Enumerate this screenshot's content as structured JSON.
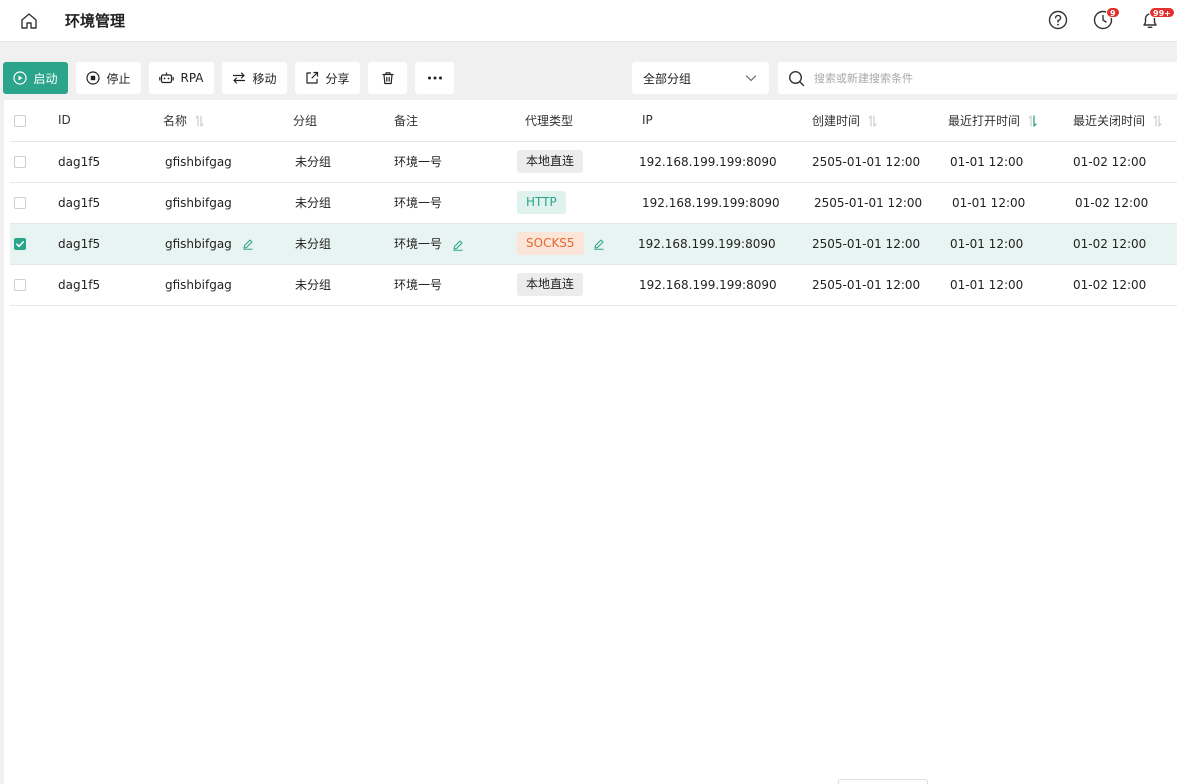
{
  "header": {
    "title": "环境管理",
    "history_badge": "9",
    "notify_badge": "99+"
  },
  "toolbar": {
    "start": "启动",
    "stop": "停止",
    "rpa": "RPA",
    "move": "移动",
    "share": "分享"
  },
  "filter": {
    "group_value": "全部分组",
    "search_placeholder": "搜索或新建搜索条件"
  },
  "table": {
    "headers": {
      "id": "ID",
      "name": "名称",
      "group": "分组",
      "note": "备注",
      "proxy": "代理类型",
      "ip": "IP",
      "created": "创建时间",
      "last_open": "最近打开时间",
      "last_close": "最近关闭时间"
    },
    "rows": [
      {
        "id": "dag1f5",
        "name": "gfishbifgag",
        "group": "未分组",
        "note": "环境一号",
        "proxy": "本地直连",
        "ip": "192.168.199.199:8090",
        "created": "2505-01-01 12:00",
        "last_open": "01-01 12:00",
        "last_close": "01-02 12:00"
      },
      {
        "id": "dag1f5",
        "name": "gfishbifgag",
        "group": "未分组",
        "note": "环境一号",
        "proxy": "HTTP",
        "ip": "192.168.199.199:8090",
        "created": "2505-01-01 12:00",
        "last_open": "01-01 12:00",
        "last_close": "01-02 12:00"
      },
      {
        "id": "dag1f5",
        "name": "gfishbifgag",
        "group": "未分组",
        "note": "环境一号",
        "proxy": "SOCKS5",
        "ip": "192.168.199.199:8090",
        "created": "2505-01-01 12:00",
        "last_open": "01-01 12:00",
        "last_close": "01-02 12:00"
      },
      {
        "id": "dag1f5",
        "name": "gfishbifgag",
        "group": "未分组",
        "note": "环境一号",
        "proxy": "本地直连",
        "ip": "192.168.199.199:8090",
        "created": "2505-01-01 12:00",
        "last_open": "01-01 12:00",
        "last_close": "01-02 12:00"
      }
    ]
  },
  "colors": {
    "accent": "#2aa48b",
    "badge": "#e0312f",
    "socks": "#e8672d"
  }
}
